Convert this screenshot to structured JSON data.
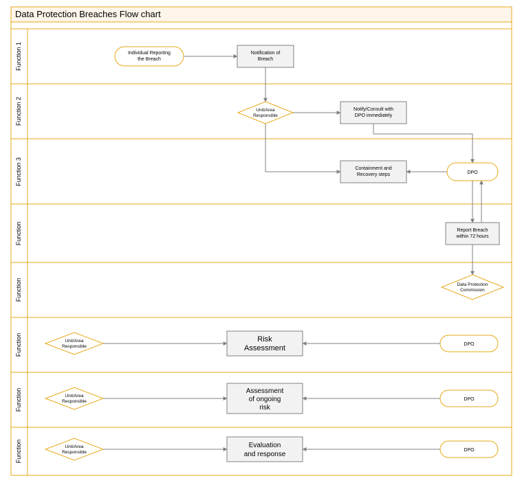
{
  "title": "Data Protection Breaches Flow chart",
  "lanes": [
    {
      "label": "Function 1"
    },
    {
      "label": "Function 2"
    },
    {
      "label": "Function 3"
    },
    {
      "label": "Function"
    },
    {
      "label": "Function"
    },
    {
      "label": "Function"
    },
    {
      "label": "Function"
    },
    {
      "label": "Function"
    }
  ],
  "nodes": {
    "terminator1": "Individual Reporting the Breach",
    "process1": "Notification of Breach",
    "decision1": "Unit/Area Responsible",
    "process2": "Notify/Consult with DPO immediately",
    "process3": "Containment and Recovery steps",
    "terminator2": "DPO",
    "process4": "Report Breach within 72 hours",
    "decision2": "Data Protection Commission",
    "decision3": "Unit/Area Responsible",
    "process5": "Risk Assessment",
    "terminator3": "DPO",
    "decision4": "Unit/Area Responsible",
    "process6": "Assessment of ongoing risk",
    "terminator4": "DPO",
    "decision5": "Unit/Area Responsible",
    "process7": "Evaluation and response",
    "terminator5": "DPO"
  },
  "colors": {
    "frame": "#e6a817",
    "titleBg": "#fdf5ea",
    "nodeFill": "#f2f2f2",
    "nodeStroke": "#808080",
    "accentStroke": "#e6a817",
    "accentFill": "#ffffff"
  }
}
